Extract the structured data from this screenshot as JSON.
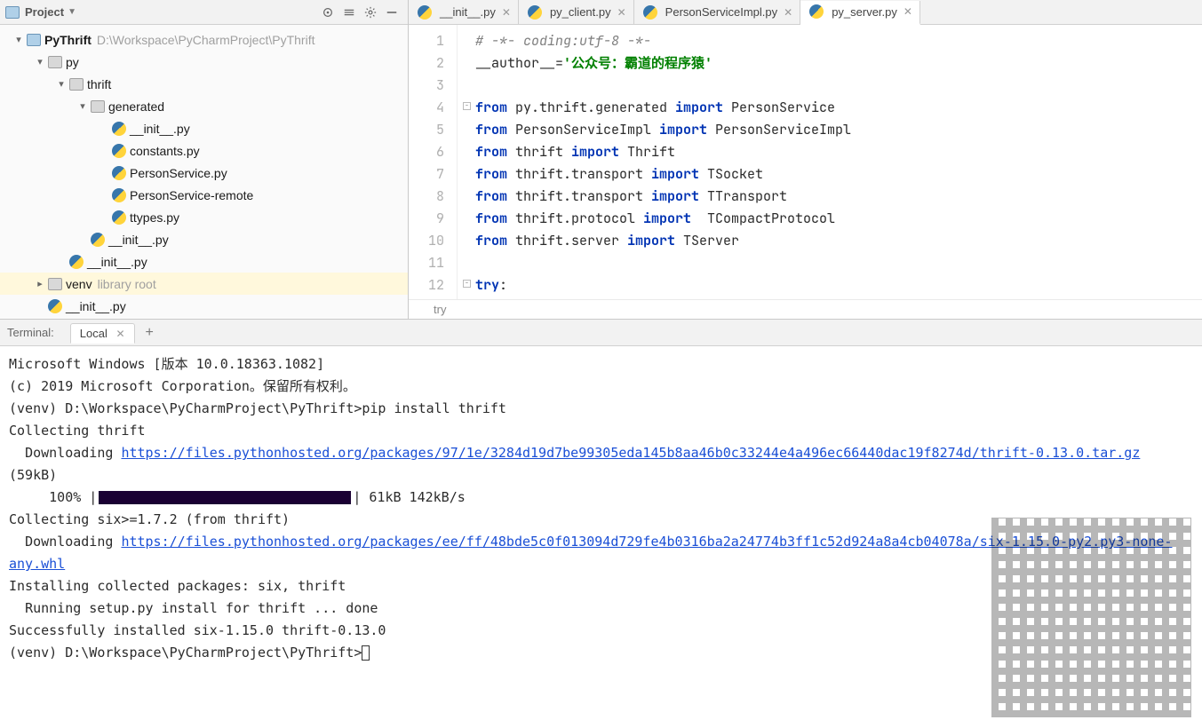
{
  "sidebar": {
    "title": "Project",
    "root": {
      "name": "PyThrift",
      "path": "D:\\Workspace\\PyCharmProject\\PyThrift"
    },
    "tree": [
      {
        "depth": 0,
        "icon": "module",
        "label": "PyThrift",
        "bold": true,
        "sub": "D:\\Workspace\\PyCharmProject\\PyThrift",
        "expand": "open"
      },
      {
        "depth": 1,
        "icon": "folder",
        "label": "py",
        "expand": "open"
      },
      {
        "depth": 2,
        "icon": "folder",
        "label": "thrift",
        "expand": "open"
      },
      {
        "depth": 3,
        "icon": "folder",
        "label": "generated",
        "expand": "open"
      },
      {
        "depth": 4,
        "icon": "py",
        "label": "__init__.py",
        "expand": "none"
      },
      {
        "depth": 4,
        "icon": "py",
        "label": "constants.py",
        "expand": "none"
      },
      {
        "depth": 4,
        "icon": "py",
        "label": "PersonService.py",
        "expand": "none"
      },
      {
        "depth": 4,
        "icon": "py",
        "label": "PersonService-remote",
        "expand": "none"
      },
      {
        "depth": 4,
        "icon": "py",
        "label": "ttypes.py",
        "expand": "none"
      },
      {
        "depth": 3,
        "icon": "py",
        "label": "__init__.py",
        "expand": "none"
      },
      {
        "depth": 2,
        "icon": "py",
        "label": "__init__.py",
        "expand": "none"
      },
      {
        "depth": 1,
        "icon": "folder",
        "label": "venv",
        "sub": "library root",
        "expand": "closed",
        "selected": true
      },
      {
        "depth": 1,
        "icon": "py",
        "label": "__init__.py",
        "expand": "none"
      }
    ]
  },
  "editor": {
    "tabs": [
      {
        "label": "__init__.py",
        "active": false
      },
      {
        "label": "py_client.py",
        "active": false
      },
      {
        "label": "PersonServiceImpl.py",
        "active": false
      },
      {
        "label": "py_server.py",
        "active": true
      }
    ],
    "breadcrumb": "try",
    "lines": [
      {
        "n": 1,
        "html": "<span class='cm'># -*- coding:utf-8 -*-</span>"
      },
      {
        "n": 2,
        "html": "__author__=<span class='st'>'公众号：霸道的程序猿'</span>"
      },
      {
        "n": 3,
        "html": ""
      },
      {
        "n": 4,
        "html": "<span class='kw'>from</span> py.thrift.generated <span class='kw'>import</span> PersonService",
        "fold": true
      },
      {
        "n": 5,
        "html": "<span class='kw'>from</span> PersonServiceImpl <span class='kw'>import</span> PersonServiceImpl"
      },
      {
        "n": 6,
        "html": "<span class='kw'>from</span> thrift <span class='kw'>import</span> Thrift"
      },
      {
        "n": 7,
        "html": "<span class='kw'>from</span> thrift.transport <span class='kw'>import</span> TSocket"
      },
      {
        "n": 8,
        "html": "<span class='kw'>from</span> thrift.transport <span class='kw'>import</span> TTransport"
      },
      {
        "n": 9,
        "html": "<span class='kw'>from</span> thrift.protocol <span class='kw'>import</span>  TCompactProtocol"
      },
      {
        "n": 10,
        "html": "<span class='kw'>from</span> thrift.server <span class='kw'>import</span> TServer"
      },
      {
        "n": 11,
        "html": ""
      },
      {
        "n": 12,
        "html": "<span class='kw'>try</span>:",
        "fold": true
      }
    ]
  },
  "terminal": {
    "title": "Terminal:",
    "tab": "Local",
    "lines": [
      "Microsoft Windows [版本 10.0.18363.1082]",
      "(c) 2019 Microsoft Corporation。保留所有权利。",
      "(venv) D:\\Workspace\\PyCharmProject\\PyThrift>pip install thrift",
      "Collecting thrift",
      "  Downloading <a>https://files.pythonhosted.org/packages/97/1e/3284d19d7be99305eda145b8aa46b0c33244e4a496ec66440dac19f8274d/thrift-0.13.0.tar.gz</a> (59kB)",
      "     100% |<span class='pbar'></span>| 61kB 142kB/s",
      "Collecting six>=1.7.2 (from thrift)",
      "  Downloading <a>https://files.pythonhosted.org/packages/ee/ff/48bde5c0f013094d729fe4b0316ba2a24774b3ff1c52d924a8a4cb04078a/six-1.15.0-py2.py3-none-any.whl</a>",
      "Installing collected packages: six, thrift",
      "  Running setup.py install for thrift ... done",
      "Successfully installed six-1.15.0 thrift-0.13.0",
      "(venv) D:\\Workspace\\PyCharmProject\\PyThrift><span class='cursor-box'></span>"
    ]
  }
}
